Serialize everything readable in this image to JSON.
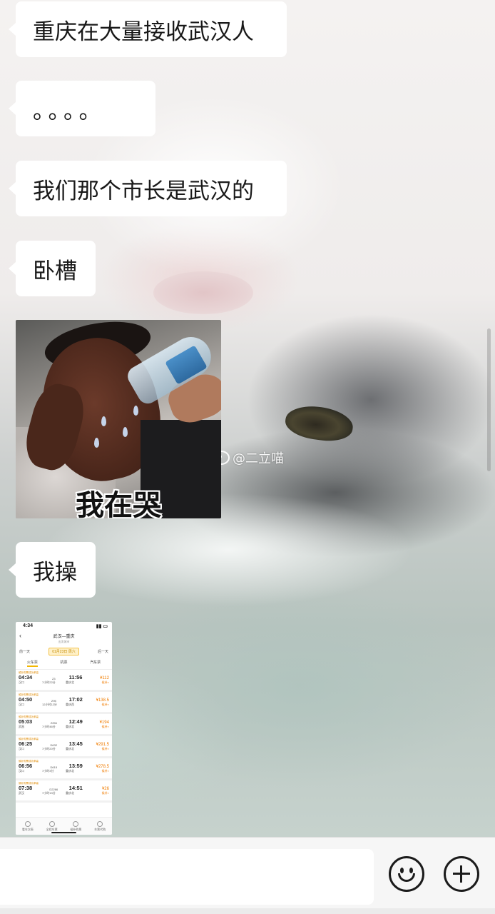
{
  "messages": [
    {
      "id": "m1",
      "type": "text",
      "text": "重庆在大量接收武汉人"
    },
    {
      "id": "m2",
      "type": "text",
      "text": "。。。。"
    },
    {
      "id": "m3",
      "type": "text",
      "text": "我们那个市长是武汉的"
    },
    {
      "id": "m4",
      "type": "text",
      "text": "卧槽"
    },
    {
      "id": "m5",
      "type": "image",
      "caption": "我在哭"
    },
    {
      "id": "m6",
      "type": "text",
      "text": "我操"
    },
    {
      "id": "m7",
      "type": "image",
      "description": "train-ticket-screenshot"
    }
  ],
  "watermark": "@二立喵",
  "ticket_screenshot": {
    "time": "4:34",
    "route": "武汉—重庆",
    "route_sub": "出发城市",
    "prev_day": "前一天",
    "next_day": "后一天",
    "date": "01月23日 周六",
    "tabs": [
      "火车票",
      "机票",
      "汽车票"
    ],
    "rows": [
      {
        "tag": "候补购票成功率高",
        "dep": "04:34",
        "train": "Z3",
        "arr": "11:56",
        "price": "¥112",
        "from": "汉口",
        "to": "重庆北",
        "dur": "7小时22分",
        "note": "候补>"
      },
      {
        "tag": "候补购票成功率高",
        "dep": "04:50",
        "train": "Z95",
        "arr": "17:02",
        "price": "¥138.5",
        "from": "汉口",
        "to": "重庆西",
        "dur": "12小时12分",
        "note": "候补>"
      },
      {
        "tag": "候补购票成功率高",
        "dep": "05:03",
        "train": "Z256",
        "arr": "12:49",
        "price": "¥194",
        "from": "武昌",
        "to": "重庆北",
        "dur": "7小时46分",
        "note": "候补>"
      },
      {
        "tag": "候补购票成功率高",
        "dep": "06:25",
        "train": "D632",
        "arr": "13:45",
        "price": "¥291.5",
        "from": "汉口",
        "to": "重庆北",
        "dur": "7小时20分",
        "note": "候补>"
      },
      {
        "tag": "候补购票成功率高",
        "dep": "06:56",
        "train": "D615",
        "arr": "13:59",
        "price": "¥278.5",
        "from": "汉口",
        "to": "重庆北",
        "dur": "7小时3分",
        "note": "候补>"
      },
      {
        "tag": "候补购票成功率高",
        "dep": "07:38",
        "train": "D2266",
        "arr": "14:51",
        "price": "¥26",
        "from": "武汉",
        "to": "重庆北",
        "dur": "7小时13分",
        "note": "候补>"
      }
    ],
    "footer": [
      "看车次表",
      "全程车票",
      "候补购票",
      "车票代购"
    ]
  },
  "input": {
    "value": "",
    "placeholder": ""
  },
  "icons": {
    "emoji": "emoji-smile-icon",
    "plus": "plus-circle-icon"
  },
  "colors": {
    "bubble": "#ffffff",
    "text": "#191919",
    "input_bar": "#f6f6f6",
    "price": "#f07c00",
    "date_highlight": "#fff1c9"
  }
}
